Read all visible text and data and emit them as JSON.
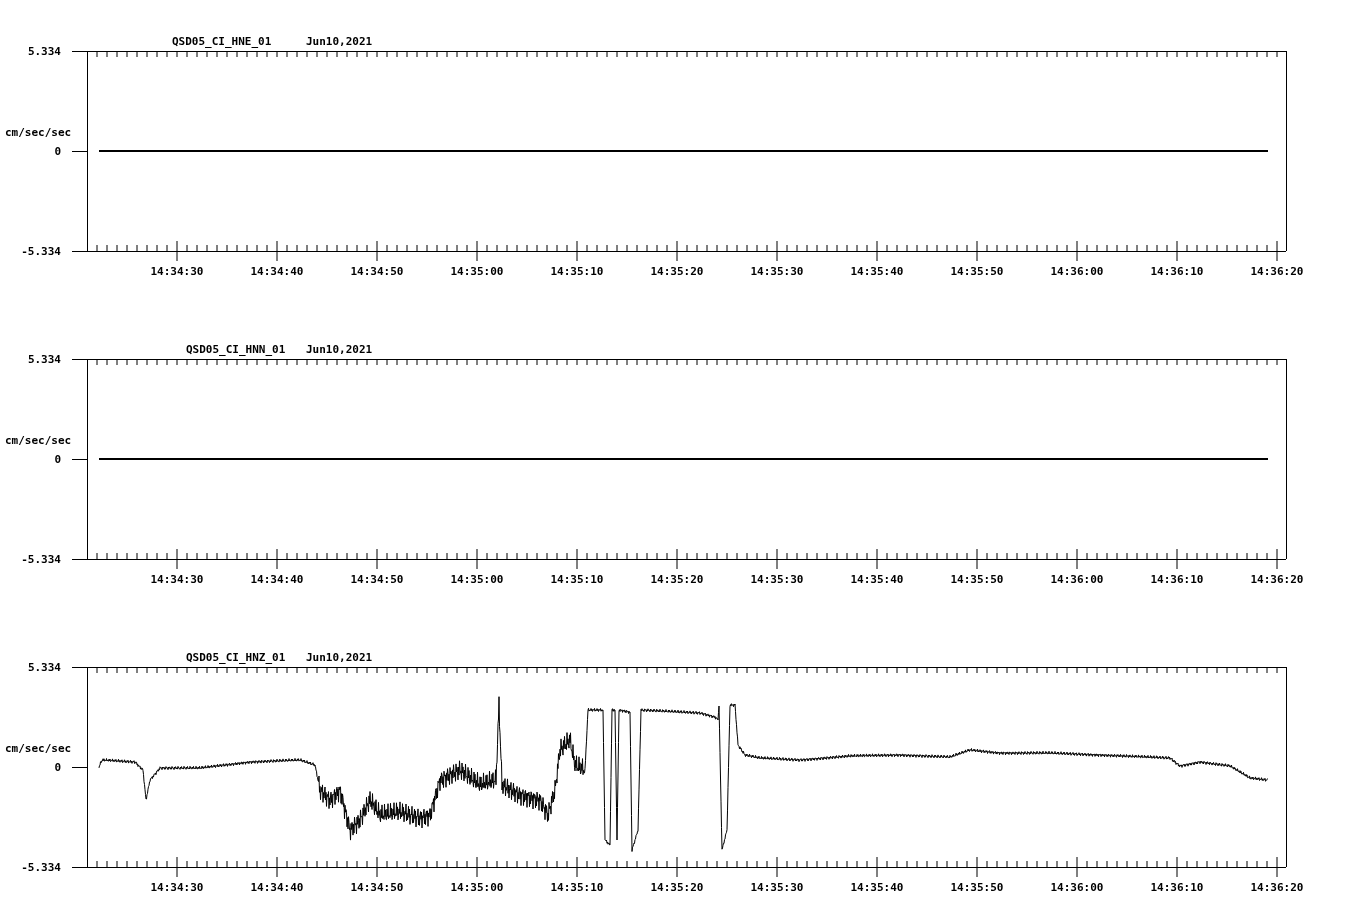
{
  "panels": [
    {
      "title": "QSD05_CI_HNE_01",
      "date": "Jun10,2021",
      "ylabel": "cm/sec/sec",
      "yticks": [
        "5.334",
        "0",
        "-5.334"
      ],
      "xticks": [
        "14:34:30",
        "14:34:40",
        "14:34:50",
        "14:35:00",
        "14:35:10",
        "14:35:20",
        "14:35:30",
        "14:35:40",
        "14:35:50",
        "14:36:00",
        "14:36:10",
        "14:36:20"
      ],
      "trace": {
        "kind": "flat"
      }
    },
    {
      "title": "QSD05_CI_HNN_01",
      "date": "Jun10,2021",
      "ylabel": "cm/sec/sec",
      "yticks": [
        "5.334",
        "0",
        "-5.334"
      ],
      "xticks": [
        "14:34:30",
        "14:34:40",
        "14:34:50",
        "14:35:00",
        "14:35:10",
        "14:35:20",
        "14:35:30",
        "14:35:40",
        "14:35:50",
        "14:36:00",
        "14:36:10",
        "14:36:20"
      ],
      "trace": {
        "kind": "flat"
      }
    },
    {
      "title": "QSD05_CI_HNZ_01",
      "date": "Jun10,2021",
      "ylabel": "cm/sec/sec",
      "yticks": [
        "5.334",
        "0",
        "-5.334"
      ],
      "xticks": [
        "14:34:30",
        "14:34:40",
        "14:34:50",
        "14:35:00",
        "14:35:10",
        "14:35:20",
        "14:35:30",
        "14:35:40",
        "14:35:50",
        "14:36:00",
        "14:36:10",
        "14:36:20"
      ],
      "trace": {
        "kind": "waveform"
      }
    }
  ]
}
